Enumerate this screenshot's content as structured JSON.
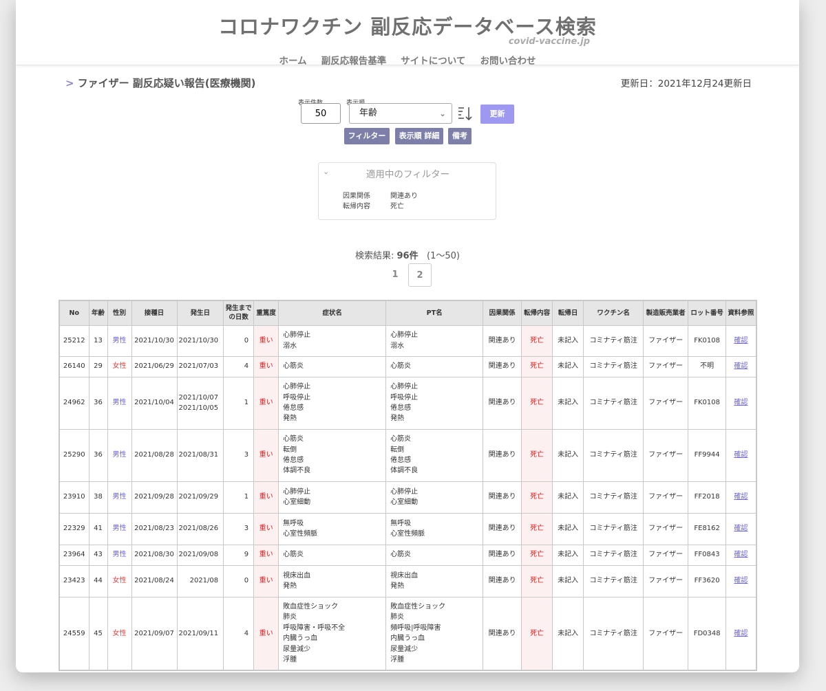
{
  "header": {
    "site_title": "コロナワクチン 副反応データベース検索",
    "domain": "covid-vaccine.jp",
    "nav": [
      "ホーム",
      "副反応報告基準",
      "サイトについて",
      "お問い合わせ"
    ]
  },
  "page": {
    "heading_marker": ">",
    "heading": "ファイザー 副反応疑い報告(医療機関)",
    "updated": "更新日：2021年12月24更新日"
  },
  "controls": {
    "count_label": "表示件数",
    "count_value": "50",
    "sort_label": "表示順",
    "sort_value": "年齢",
    "update_button": "更新",
    "filter_button": "フィルター",
    "sort_detail_button": "表示順 詳細",
    "notes_button": "備考"
  },
  "filter_panel": {
    "title": "適用中のフィルター",
    "rows": [
      {
        "key": "因果関係",
        "value": "関連あり"
      },
      {
        "key": "転帰内容",
        "value": "死亡"
      }
    ]
  },
  "results": {
    "prefix": "検索結果: ",
    "count": "96件",
    "range": "(1〜50)",
    "pages": [
      "1",
      "2"
    ]
  },
  "table": {
    "columns": [
      "No",
      "年齢",
      "性別",
      "接種日",
      "発生日",
      "発生までの日数",
      "重篤度",
      "症状名",
      "PT名",
      "因果関係",
      "転帰内容",
      "転帰日",
      "ワクチン名",
      "製造販売業者",
      "ロット番号",
      "資料参照"
    ],
    "rows": [
      {
        "no": "25212",
        "age": "13",
        "sex": "男性",
        "vax_date": "2021/10/30",
        "onset": "2021/10/30",
        "days": "0",
        "severity": "重い",
        "symptoms": "心肺停止\n溺水",
        "pt": "心肺停止\n溺水",
        "causality": "関連あり",
        "outcome": "死亡",
        "outcome_date": "未記入",
        "vaccine": "コミナティ筋注",
        "maker": "ファイザー",
        "lot": "FK0108",
        "ref": "確認"
      },
      {
        "no": "26140",
        "age": "29",
        "sex": "女性",
        "vax_date": "2021/06/29",
        "onset": "2021/07/03",
        "days": "4",
        "severity": "重い",
        "symptoms": "心筋炎",
        "pt": "心筋炎",
        "causality": "関連あり",
        "outcome": "死亡",
        "outcome_date": "未記入",
        "vaccine": "コミナティ筋注",
        "maker": "ファイザー",
        "lot": "不明",
        "ref": "確認"
      },
      {
        "no": "24962",
        "age": "36",
        "sex": "男性",
        "vax_date": "2021/10/04",
        "onset": "2021/10/07\n2021/10/05",
        "days": "1",
        "severity": "重い",
        "symptoms": "心肺停止\n呼吸停止\n倦怠感\n発熱",
        "pt": "心肺停止\n呼吸停止\n倦怠感\n発熱",
        "causality": "関連あり",
        "outcome": "死亡",
        "outcome_date": "未記入",
        "vaccine": "コミナティ筋注",
        "maker": "ファイザー",
        "lot": "FK0108",
        "ref": "確認"
      },
      {
        "no": "25290",
        "age": "36",
        "sex": "男性",
        "vax_date": "2021/08/28",
        "onset": "2021/08/31",
        "days": "3",
        "severity": "重い",
        "symptoms": "心筋炎\n転倒\n倦怠感\n体調不良",
        "pt": "心筋炎\n転倒\n倦怠感\n体調不良",
        "causality": "関連あり",
        "outcome": "死亡",
        "outcome_date": "未記入",
        "vaccine": "コミナティ筋注",
        "maker": "ファイザー",
        "lot": "FF9944",
        "ref": "確認"
      },
      {
        "no": "23910",
        "age": "38",
        "sex": "男性",
        "vax_date": "2021/09/28",
        "onset": "2021/09/29",
        "days": "1",
        "severity": "重い",
        "symptoms": "心肺停止\n心室細動",
        "pt": "心肺停止\n心室細動",
        "causality": "関連あり",
        "outcome": "死亡",
        "outcome_date": "未記入",
        "vaccine": "コミナティ筋注",
        "maker": "ファイザー",
        "lot": "FF2018",
        "ref": "確認"
      },
      {
        "no": "22329",
        "age": "41",
        "sex": "男性",
        "vax_date": "2021/08/23",
        "onset": "2021/08/26",
        "days": "3",
        "severity": "重い",
        "symptoms": "無呼吸\n心室性頻脈",
        "pt": "無呼吸\n心室性頻脈",
        "causality": "関連あり",
        "outcome": "死亡",
        "outcome_date": "未記入",
        "vaccine": "コミナティ筋注",
        "maker": "ファイザー",
        "lot": "FE8162",
        "ref": "確認"
      },
      {
        "no": "23964",
        "age": "43",
        "sex": "男性",
        "vax_date": "2021/08/30",
        "onset": "2021/09/08",
        "days": "9",
        "severity": "重い",
        "symptoms": "心筋炎",
        "pt": "心筋炎",
        "causality": "関連あり",
        "outcome": "死亡",
        "outcome_date": "未記入",
        "vaccine": "コミナティ筋注",
        "maker": "ファイザー",
        "lot": "FF0843",
        "ref": "確認"
      },
      {
        "no": "23423",
        "age": "44",
        "sex": "女性",
        "vax_date": "2021/08/24",
        "onset": "2021/08",
        "days": "0",
        "severity": "重い",
        "symptoms": "視床出血\n発熱",
        "pt": "視床出血\n発熱",
        "causality": "関連あり",
        "outcome": "死亡",
        "outcome_date": "未記入",
        "vaccine": "コミナティ筋注",
        "maker": "ファイザー",
        "lot": "FF3620",
        "ref": "確認"
      },
      {
        "no": "24559",
        "age": "45",
        "sex": "女性",
        "vax_date": "2021/09/07",
        "onset": "2021/09/11",
        "days": "4",
        "severity": "重い",
        "symptoms": "敗血症性ショック\n肺炎\n呼吸障害・呼吸不全\n内臓うっ血\n尿量減少\n浮腫",
        "pt": "敗血症性ショック\n肺炎\n頻呼吸|呼吸障害\n内臓うっ血\n尿量減少\n浮腫",
        "causality": "関連あり",
        "outcome": "死亡",
        "outcome_date": "未記入",
        "vaccine": "コミナティ筋注",
        "maker": "ファイザー",
        "lot": "FD0348",
        "ref": "確認"
      }
    ]
  },
  "colors": {
    "accent": "#9e98f0",
    "button_secondary": "#7d7fa8",
    "male": "#6b62e6",
    "female": "#e63e3e",
    "severe": "#e02020",
    "highlight_cell": "#fdf0f0"
  }
}
